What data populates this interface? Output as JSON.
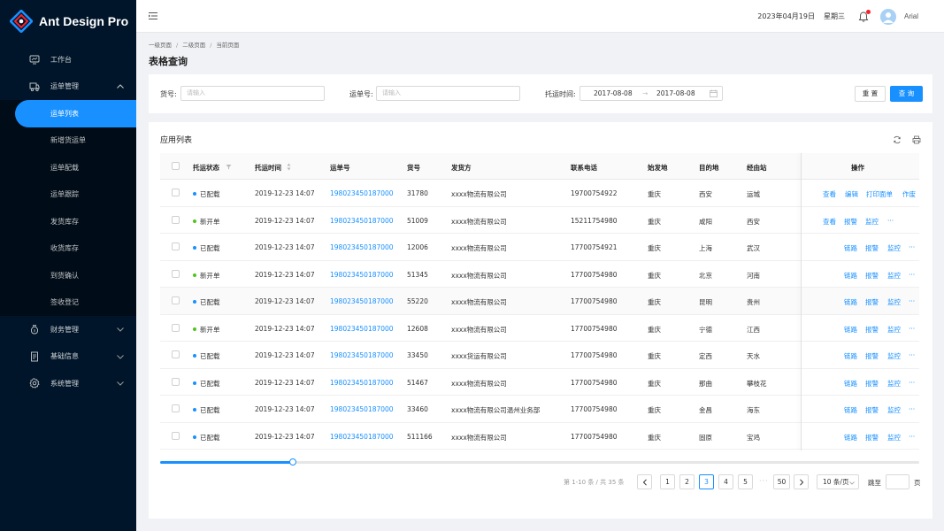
{
  "app": {
    "title": "Ant Design Pro"
  },
  "sidebar": {
    "items": [
      {
        "label": "工作台",
        "icon": "monitor-icon"
      },
      {
        "label": "运单管理",
        "icon": "truck-icon",
        "expanded": true,
        "children": [
          "运单列表",
          "新增货运单",
          "运单配载",
          "运单跟踪",
          "发货库存",
          "收货库存",
          "到货确认",
          "签收登记"
        ]
      },
      {
        "label": "财务管理",
        "icon": "money-bag-icon"
      },
      {
        "label": "基础信息",
        "icon": "document-icon"
      },
      {
        "label": "系统管理",
        "icon": "gear-icon"
      }
    ],
    "active_child": "运单列表"
  },
  "header": {
    "date": "2023年04月19日",
    "weekday": "星期三",
    "user": "Arial"
  },
  "breadcrumb": [
    "一级页面",
    "二级页面",
    "当前页面"
  ],
  "page_title": "表格查询",
  "filter": {
    "cargo_label": "货号:",
    "cargo_placeholder": "请输入",
    "waybill_label": "运单号:",
    "waybill_placeholder": "请输入",
    "time_label": "托运时间:",
    "date_start": "2017-08-08",
    "date_end": "2017-08-08",
    "date_sep": "→",
    "reset": "重 置",
    "query": "查 询"
  },
  "table": {
    "title": "应用列表",
    "columns": [
      "托运状态",
      "托运时间",
      "运单号",
      "货号",
      "发货方",
      "联系电话",
      "始发地",
      "目的地",
      "经由站",
      "操作"
    ],
    "rows": [
      {
        "status": "已配载",
        "time": "2019-12-23 14:07",
        "waybill": "198023450187000",
        "cargo": "31780",
        "shipper": "xxxx物流有限公司",
        "phone": "19700754922",
        "origin": "重庆",
        "dest": "西安",
        "via": "运城",
        "ops": [
          "查看",
          "编辑",
          "打印面单",
          "作废"
        ]
      },
      {
        "status": "新开单",
        "time": "2019-12-23 14:07",
        "waybill": "198023450187000",
        "cargo": "51009",
        "shipper": "xxxx物流有限公司",
        "phone": "15211754980",
        "origin": "重庆",
        "dest": "咸阳",
        "via": "西安",
        "ops": [
          "查看",
          "报警",
          "监控",
          "···"
        ]
      },
      {
        "status": "已配载",
        "time": "2019-12-23 14:07",
        "waybill": "198023450187000",
        "cargo": "12006",
        "shipper": "xxxx物流有限公司",
        "phone": "17700754921",
        "origin": "重庆",
        "dest": "上海",
        "via": "武汉",
        "ops": [
          "链路",
          "报警",
          "监控",
          "···"
        ]
      },
      {
        "status": "新开单",
        "time": "2019-12-23 14:07",
        "waybill": "198023450187000",
        "cargo": "51345",
        "shipper": "xxxx物流有限公司",
        "phone": "17700754980",
        "origin": "重庆",
        "dest": "北京",
        "via": "河南",
        "ops": [
          "链路",
          "报警",
          "监控",
          "···"
        ]
      },
      {
        "status": "已配载",
        "time": "2019-12-23 14:07",
        "waybill": "198023450187000",
        "cargo": "55220",
        "shipper": "xxxx物流有限公司",
        "phone": "17700754980",
        "origin": "重庆",
        "dest": "昆明",
        "via": "贵州",
        "ops": [
          "链路",
          "报警",
          "监控",
          "···"
        ]
      },
      {
        "status": "新开单",
        "time": "2019-12-23 14:07",
        "waybill": "198023450187000",
        "cargo": "12608",
        "shipper": "xxxx物流有限公司",
        "phone": "17700754980",
        "origin": "重庆",
        "dest": "宁德",
        "via": "江西",
        "ops": [
          "链路",
          "报警",
          "监控",
          "···"
        ]
      },
      {
        "status": "已配载",
        "time": "2019-12-23 14:07",
        "waybill": "198023450187000",
        "cargo": "33450",
        "shipper": "xxxx货运有限公司",
        "phone": "17700754980",
        "origin": "重庆",
        "dest": "定西",
        "via": "天水",
        "ops": [
          "链路",
          "报警",
          "监控",
          "···"
        ]
      },
      {
        "status": "已配载",
        "time": "2019-12-23 14:07",
        "waybill": "198023450187000",
        "cargo": "51467",
        "shipper": "xxxx物流有限公司",
        "phone": "17700754980",
        "origin": "重庆",
        "dest": "那曲",
        "via": "攀枝花",
        "ops": [
          "链路",
          "报警",
          "监控",
          "···"
        ]
      },
      {
        "status": "已配载",
        "time": "2019-12-23 14:07",
        "waybill": "198023450187000",
        "cargo": "33460",
        "shipper": "xxxx物流有限公司温州业务部",
        "phone": "17700754980",
        "origin": "重庆",
        "dest": "金昌",
        "via": "海东",
        "ops": [
          "链路",
          "报警",
          "监控",
          "···"
        ]
      },
      {
        "status": "已配载",
        "time": "2019-12-23 14:07",
        "waybill": "198023450187000",
        "cargo": "511166",
        "shipper": "xxxx物流有限公司",
        "phone": "17700754980",
        "origin": "重庆",
        "dest": "固原",
        "via": "宝鸡",
        "ops": [
          "链路",
          "报警",
          "监控",
          "···"
        ]
      }
    ],
    "highlighted_row": 4
  },
  "status_colors": {
    "已配载": "#1890ff",
    "新开单": "#52c41a"
  },
  "pagination": {
    "total_text": "第 1-10 条 / 共 35 条",
    "pages": [
      "1",
      "2",
      "3",
      "4",
      "5"
    ],
    "current": "3",
    "ellipsis": "···",
    "last": "50",
    "page_size": "10 条/页",
    "jump_label": "跳至",
    "jump_unit": "页"
  },
  "colors": {
    "primary": "#1890ff",
    "sidebar_bg": "#001529"
  }
}
